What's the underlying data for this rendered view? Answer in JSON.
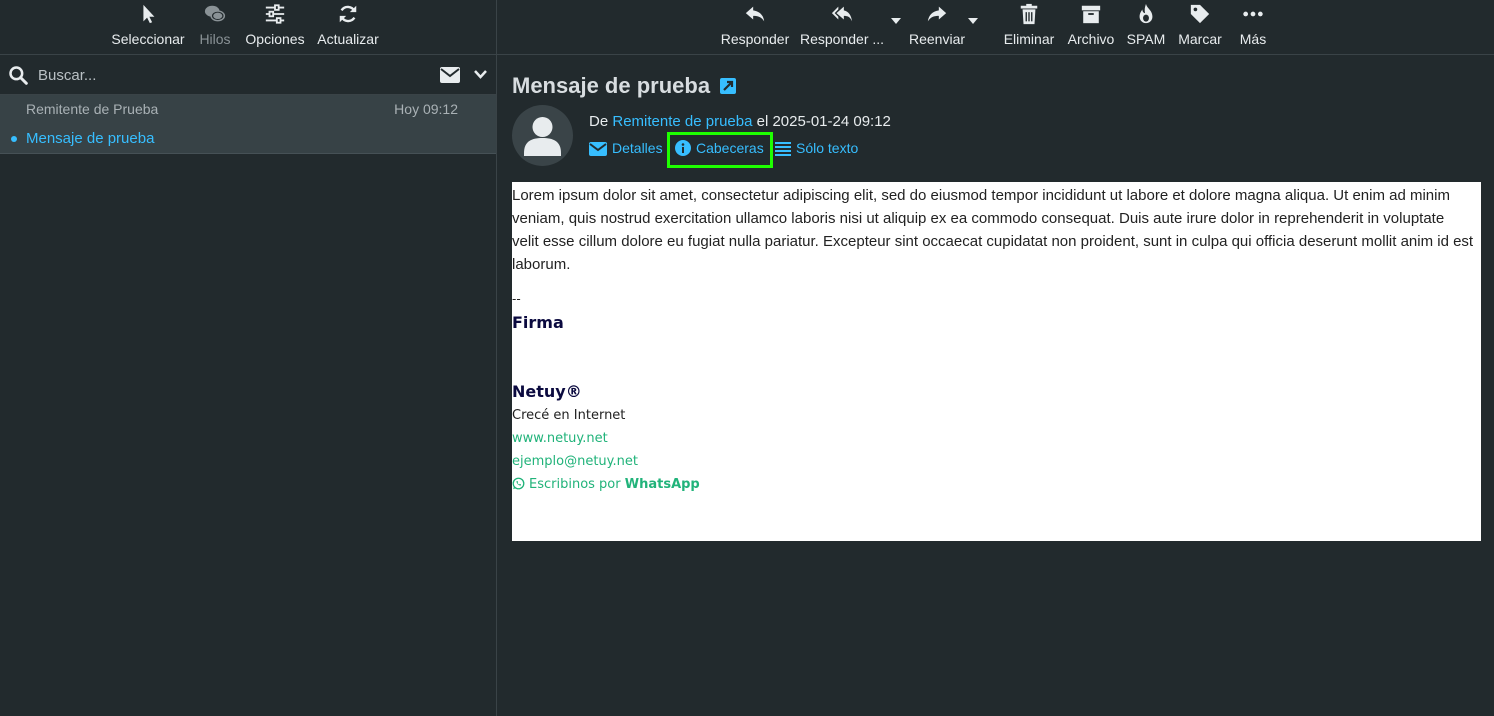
{
  "left_toolbar": {
    "select": "Seleccionar",
    "threads": "Hilos",
    "options": "Opciones",
    "refresh": "Actualizar"
  },
  "search": {
    "placeholder": "Buscar..."
  },
  "message_list": [
    {
      "from": "Remitente de Prueba",
      "date": "Hoy 09:12",
      "subject": "Mensaje de prueba"
    }
  ],
  "right_toolbar": {
    "reply": "Responder",
    "reply_all": "Responder ...",
    "forward": "Reenviar",
    "delete": "Eliminar",
    "archive": "Archivo",
    "spam": "SPAM",
    "mark": "Marcar",
    "more": "Más"
  },
  "message": {
    "subject": "Mensaje de prueba",
    "from_prefix": "De",
    "from_name": "Remitente de prueba",
    "date_text": "el 2025-01-24 09:12",
    "links": {
      "details": "Detalles",
      "headers": "Cabeceras",
      "plain": "Sólo texto"
    },
    "body": "Lorem ipsum dolor sit amet, consectetur adipiscing elit, sed do eiusmod tempor incididunt ut labore et dolore magna aliqua. Ut enim ad minim veniam, quis nostrud exercitation ullamco laboris nisi ut aliquip ex ea commodo consequat. Duis aute irure dolor in reprehenderit in voluptate velit esse cillum dolore eu fugiat nulla pariatur. Excepteur sint occaecat cupidatat non proident, sunt in culpa qui officia deserunt mollit anim id est laborum.",
    "signature": {
      "separator": "--",
      "title": "Firma",
      "brand": "Netuy®",
      "tagline": "Crecé en Internet",
      "website": "www.netuy.net",
      "email": "ejemplo@netuy.net",
      "whatsapp_prefix": "Escribinos por",
      "whatsapp_label": "WhatsApp"
    }
  },
  "colors": {
    "accent": "#37beff",
    "highlight": "#1eff00",
    "signature_green": "#21b37a",
    "signature_navy": "#0b0a3f"
  }
}
